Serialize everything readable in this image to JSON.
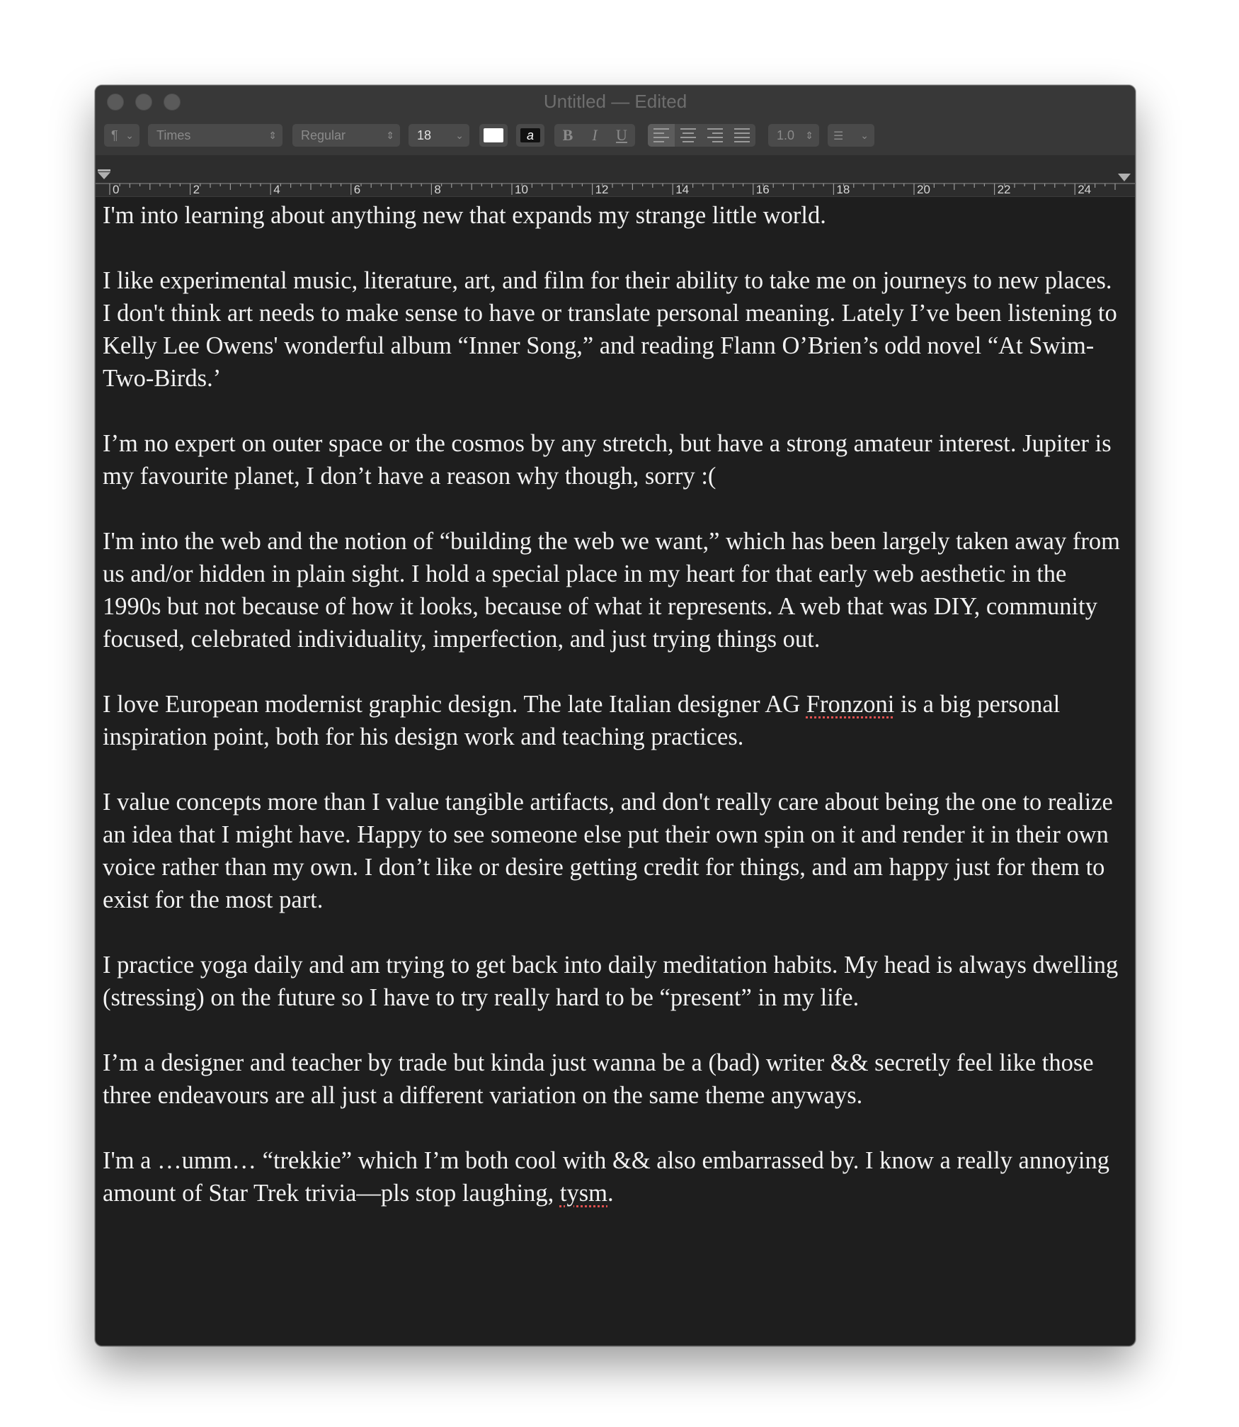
{
  "window": {
    "title": "Untitled — Edited"
  },
  "toolbar": {
    "paragraph_style": "¶",
    "font_family": "Times",
    "font_style": "Regular",
    "font_size": "18",
    "text_color": "#ffffff",
    "background_color_label": "a",
    "bold_label": "B",
    "italic_label": "I",
    "underline_label": "U",
    "line_spacing": "1.0"
  },
  "ruler": {
    "labels": [
      "0",
      "2",
      "4",
      "6",
      "8",
      "10",
      "12",
      "14",
      "16",
      "18",
      "20",
      "22",
      "24"
    ]
  },
  "document": {
    "paragraphs": [
      {
        "text": "I'm into learning about anything new that expands my strange little world."
      },
      {
        "text": "I like experimental music, literature, art, and film for their ability to take me on journeys to new places. I don't think art needs to make sense to have or translate personal meaning. Lately I’ve been listening to Kelly Lee Owens' wonderful album “Inner Song,” and reading Flann O’Brien’s odd novel “At Swim-Two-Birds.’"
      },
      {
        "text": "I’m no expert on outer space or the cosmos by any stretch, but have a strong amateur interest. Jupiter is my favourite planet, I don’t have a reason why though, sorry :("
      },
      {
        "text": "I'm into the web and the notion of “building the web we want,” which has been largely taken away from us and/or hidden in plain sight. I hold a special place in my heart for that early web aesthetic in the 1990s but not because of how it looks, because of what it represents. A web that was DIY, community focused, celebrated individuality, imperfection, and just trying things out."
      },
      {
        "before": "I love European modernist graphic design. The late Italian designer AG ",
        "misspelled": "Fronzoni",
        "after": " is a big personal inspiration point, both for his design work and teaching practices."
      },
      {
        "text": "I value concepts more than I value tangible artifacts, and don't really care about being the one to realize an idea that I might have. Happy to see someone else put their own spin on it and render it in their own voice rather than my own. I don’t like or desire getting credit for things, and am happy just for them to exist for the most part."
      },
      {
        "text": "I practice yoga daily and am trying to get back into daily meditation habits. My head is always dwelling (stressing) on the future so I have to try really hard to be “present” in my life."
      },
      {
        "text": "I’m a designer and teacher by trade but kinda just wanna be a (bad) writer && secretly feel like those three endeavours are all just a different variation on the same theme anyways."
      },
      {
        "before": "I'm a …umm… “trekkie” which I’m both cool with && also embarrassed by. I know a really annoying amount of Star Trek trivia—pls stop laughing, ",
        "misspelled": "tysm",
        "after": "."
      }
    ]
  }
}
